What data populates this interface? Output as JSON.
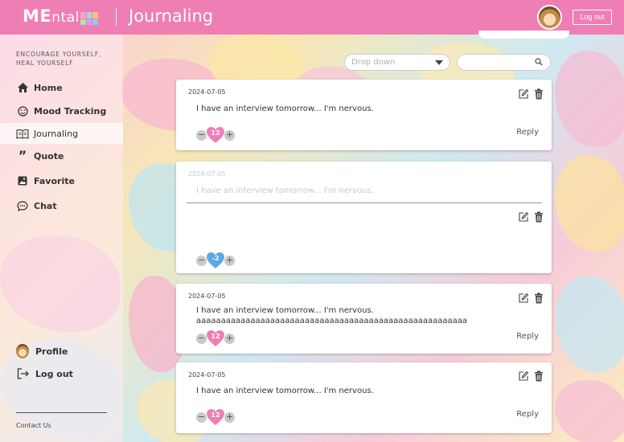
{
  "header": {
    "logo_bold": "ME",
    "logo_rest": "ntal",
    "page_title": "Journaling",
    "logout_label": "Log out"
  },
  "sidebar": {
    "tagline": "ENCOURAGE YOURSELF, HEAL YOURSELF",
    "items": [
      {
        "label": "Home",
        "icon": "home-icon"
      },
      {
        "label": "Mood Tracking",
        "icon": "smile-icon"
      },
      {
        "label": "Journaling",
        "icon": "book-icon"
      },
      {
        "label": "Quote",
        "icon": "quote-icon"
      },
      {
        "label": "Favorite",
        "icon": "image-icon"
      },
      {
        "label": "Chat",
        "icon": "chat-icon"
      }
    ],
    "profile_label": "Profile",
    "logout_label": "Log out",
    "contact_label": "Contact Us"
  },
  "controls": {
    "dropdown_value": "Drop down",
    "search_value": ""
  },
  "entries": [
    {
      "date": "2024-07-05",
      "text": "I have an interview tomorrow... I'm nervous.",
      "count": "12",
      "heart_color": "#ef7eb4",
      "reply": "Reply"
    },
    {
      "date": "2024-07-05",
      "text": "I have an interview tomorrow... I'm nervous.",
      "count": "-2",
      "heart_color": "#5aa8e8",
      "reply": ""
    },
    {
      "date": "2024-07-05",
      "text": "I have an interview tomorrow... I'm nervous.",
      "text2": "aaaaaaaaaaaaaaaaaaaaaaaaaaaaaaaaaaaaaaaaaaaaaaaaaaaaaaa",
      "count": "12",
      "heart_color": "#ef7eb4",
      "reply": "Reply"
    },
    {
      "date": "2024-07-05",
      "text": "I have an interview tomorrow... I'm nervous.",
      "count": "12",
      "heart_color": "#ef7eb4",
      "reply": "Reply"
    }
  ],
  "colors": {
    "brand_pink": "#ef7eb4",
    "heart_blue": "#5aa8e8"
  }
}
